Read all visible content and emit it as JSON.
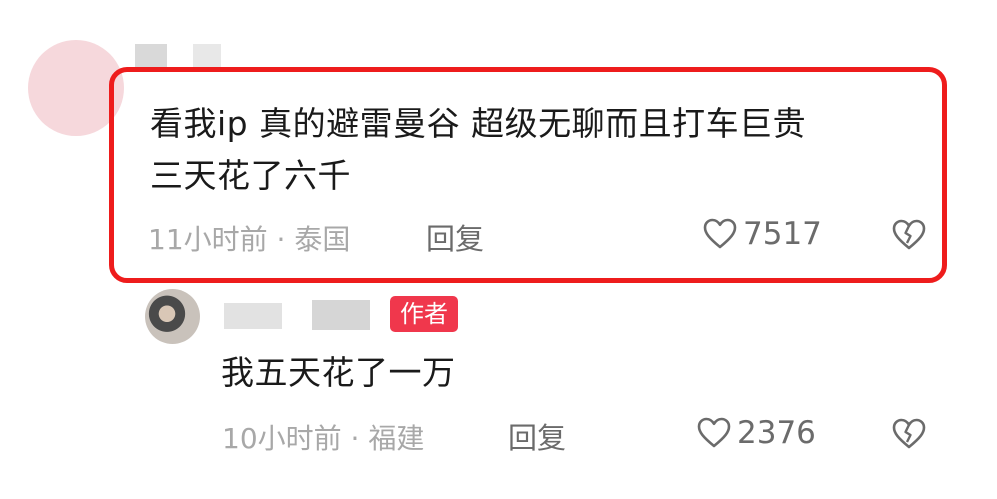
{
  "comment": {
    "text_line1": "看我ip 真的避雷曼谷 超级无聊而且打车巨贵",
    "text_line2": "三天花了六千",
    "time_location": "11小时前 · 泰国",
    "reply_label": "回复",
    "likes": "7517"
  },
  "reply": {
    "badge": "作者",
    "text": "我五天花了一万",
    "time_location": "10小时前 · 福建",
    "reply_label": "回复",
    "likes": "2376"
  },
  "colors": {
    "highlight_border": "#ee1c1c",
    "author_badge": "#f0374c"
  },
  "icons": [
    "heart-outline-icon",
    "broken-heart-icon"
  ]
}
